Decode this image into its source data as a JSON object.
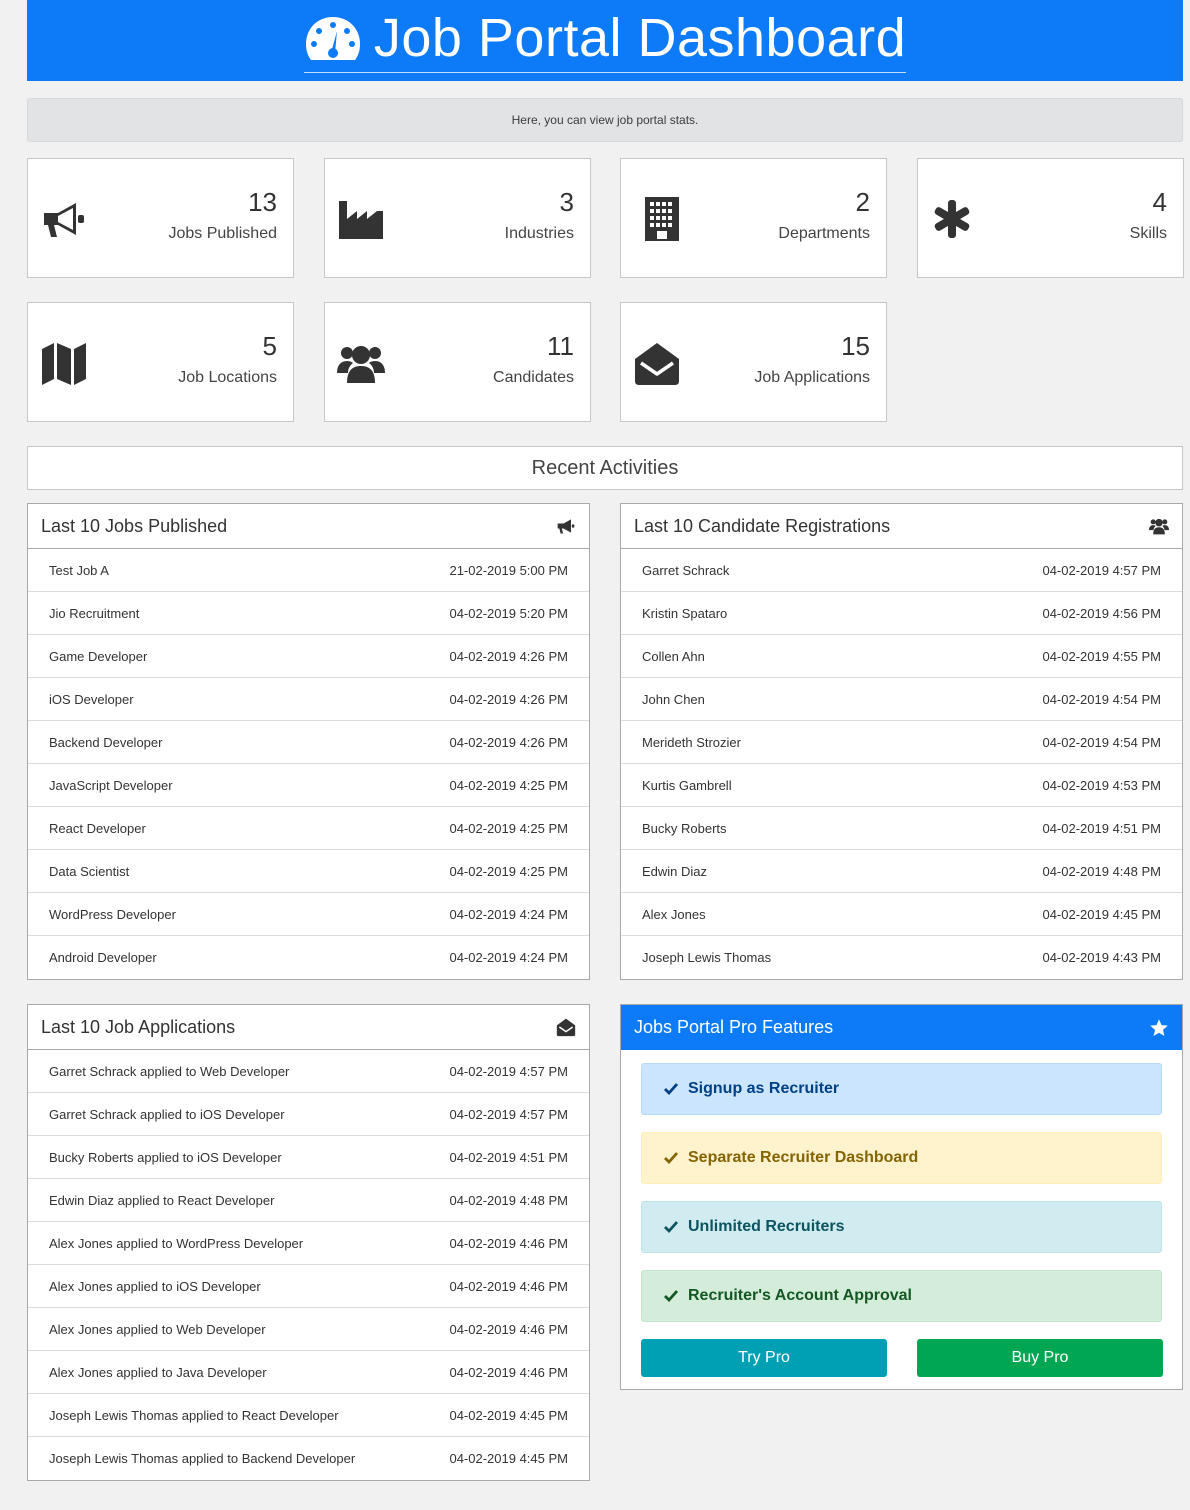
{
  "header": {
    "title": "Job Portal Dashboard"
  },
  "notice": "Here, you can view job portal stats.",
  "stats": [
    {
      "value": "13",
      "label": "Jobs Published",
      "icon": "megaphone-icon"
    },
    {
      "value": "3",
      "label": "Industries",
      "icon": "factory-icon"
    },
    {
      "value": "2",
      "label": "Departments",
      "icon": "building-icon"
    },
    {
      "value": "4",
      "label": "Skills",
      "icon": "asterisk-icon"
    },
    {
      "value": "5",
      "label": "Job Locations",
      "icon": "map-icon"
    },
    {
      "value": "11",
      "label": "Candidates",
      "icon": "users-icon"
    },
    {
      "value": "15",
      "label": "Job Applications",
      "icon": "envelope-open-icon"
    }
  ],
  "recent_title": "Recent Activities",
  "jobs_panel": {
    "title": "Last 10 Jobs Published",
    "rows": [
      {
        "name": "Test Job A",
        "date": "21-02-2019 5:00 PM"
      },
      {
        "name": "Jio Recruitment",
        "date": "04-02-2019 5:20 PM"
      },
      {
        "name": "Game Developer",
        "date": "04-02-2019 4:26 PM"
      },
      {
        "name": "iOS Developer",
        "date": "04-02-2019 4:26 PM"
      },
      {
        "name": "Backend Developer",
        "date": "04-02-2019 4:26 PM"
      },
      {
        "name": "JavaScript Developer",
        "date": "04-02-2019 4:25 PM"
      },
      {
        "name": "React Developer",
        "date": "04-02-2019 4:25 PM"
      },
      {
        "name": "Data Scientist",
        "date": "04-02-2019 4:25 PM"
      },
      {
        "name": "WordPress Developer",
        "date": "04-02-2019 4:24 PM"
      },
      {
        "name": "Android Developer",
        "date": "04-02-2019 4:24 PM"
      }
    ]
  },
  "candidates_panel": {
    "title": "Last 10 Candidate Registrations",
    "rows": [
      {
        "name": "Garret Schrack",
        "date": "04-02-2019 4:57 PM"
      },
      {
        "name": "Kristin Spataro",
        "date": "04-02-2019 4:56 PM"
      },
      {
        "name": "Collen Ahn",
        "date": "04-02-2019 4:55 PM"
      },
      {
        "name": "John Chen",
        "date": "04-02-2019 4:54 PM"
      },
      {
        "name": "Merideth Strozier",
        "date": "04-02-2019 4:54 PM"
      },
      {
        "name": "Kurtis Gambrell",
        "date": "04-02-2019 4:53 PM"
      },
      {
        "name": "Bucky Roberts",
        "date": "04-02-2019 4:51 PM"
      },
      {
        "name": "Edwin Diaz",
        "date": "04-02-2019 4:48 PM"
      },
      {
        "name": "Alex Jones",
        "date": "04-02-2019 4:45 PM"
      },
      {
        "name": "Joseph Lewis Thomas",
        "date": "04-02-2019 4:43 PM"
      }
    ]
  },
  "applications_panel": {
    "title": "Last 10 Job Applications",
    "rows": [
      {
        "name": "Garret Schrack applied to Web Developer",
        "date": "04-02-2019 4:57 PM"
      },
      {
        "name": "Garret Schrack applied to iOS Developer",
        "date": "04-02-2019 4:57 PM"
      },
      {
        "name": "Bucky Roberts applied to iOS Developer",
        "date": "04-02-2019 4:51 PM"
      },
      {
        "name": "Edwin Diaz applied to React Developer",
        "date": "04-02-2019 4:48 PM"
      },
      {
        "name": "Alex Jones applied to WordPress Developer",
        "date": "04-02-2019 4:46 PM"
      },
      {
        "name": "Alex Jones applied to iOS Developer",
        "date": "04-02-2019 4:46 PM"
      },
      {
        "name": "Alex Jones applied to Web Developer",
        "date": "04-02-2019 4:46 PM"
      },
      {
        "name": "Alex Jones applied to Java Developer",
        "date": "04-02-2019 4:46 PM"
      },
      {
        "name": "Joseph Lewis Thomas applied to React Developer",
        "date": "04-02-2019 4:45 PM"
      },
      {
        "name": "Joseph Lewis Thomas applied to Backend Developer",
        "date": "04-02-2019 4:45 PM"
      }
    ]
  },
  "pro_panel": {
    "title": "Jobs Portal Pro Features",
    "features": [
      "Signup as Recruiter",
      "Separate Recruiter Dashboard",
      "Unlimited Recruiters",
      "Recruiter's Account Approval"
    ],
    "try_label": "Try Pro",
    "buy_label": "Buy Pro"
  },
  "colors": {
    "header_bg": "#0d7bf8",
    "try_button": "#00a0b4",
    "buy_button": "#00a651"
  }
}
